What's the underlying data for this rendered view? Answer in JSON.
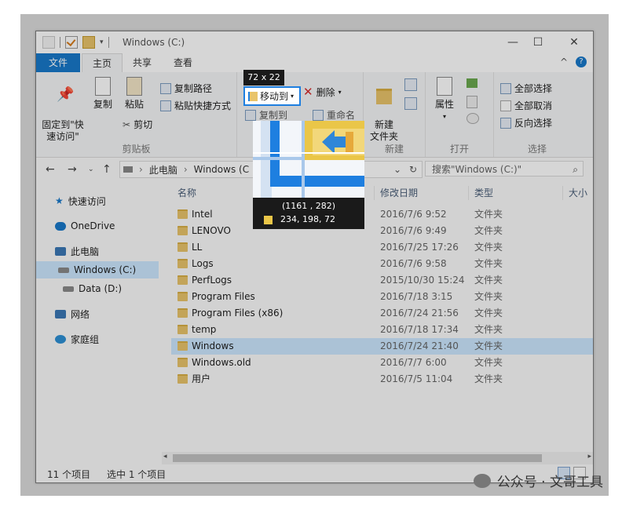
{
  "window": {
    "title": "Windows (C:)",
    "minimize": "—",
    "maximize": "☐",
    "close": "✕"
  },
  "menu": {
    "file": "文件",
    "home": "主页",
    "share": "共享",
    "view": "查看",
    "collapse": "^",
    "help": "?"
  },
  "ribbon": {
    "clipboard": {
      "pin": "固定到\"快\n速访问\"",
      "copy": "复制",
      "paste": "粘贴",
      "copy_path": "复制路径",
      "paste_shortcut": "粘贴快捷方式",
      "cut": "剪切",
      "label": "剪贴板"
    },
    "organize": {
      "move_to": "移动到",
      "copy_to": "复制到",
      "delete": "删除",
      "rename": "重命名"
    },
    "new": {
      "new_folder": "新建\n文件夹",
      "label": "新建"
    },
    "open": {
      "properties": "属性",
      "label": "打开"
    },
    "select": {
      "select_all": "全部选择",
      "select_none": "全部取消",
      "invert": "反向选择",
      "label": "选择"
    }
  },
  "address": {
    "crumb1": "此电脑",
    "crumb2": "Windows (C",
    "search_placeholder": "搜索\"Windows (C:)\""
  },
  "sidebar": {
    "items": [
      {
        "label": "快速访问",
        "icon": "star-icon"
      },
      {
        "label": "OneDrive",
        "icon": "cloud-icon"
      },
      {
        "label": "此电脑",
        "icon": "computer-icon"
      },
      {
        "label": "Windows (C:)",
        "icon": "drive-icon"
      },
      {
        "label": "Data (D:)",
        "icon": "drive-icon"
      },
      {
        "label": "网络",
        "icon": "network-icon"
      },
      {
        "label": "家庭组",
        "icon": "homegroup-icon"
      }
    ]
  },
  "columns": {
    "name": "名称",
    "date": "修改日期",
    "type": "类型",
    "size": "大小"
  },
  "files": [
    {
      "name": "Intel",
      "date": "2016/7/6 9:52",
      "type": "文件夹"
    },
    {
      "name": "LENOVO",
      "date": "2016/7/6 9:49",
      "type": "文件夹"
    },
    {
      "name": "LL",
      "date": "2016/7/25 17:26",
      "type": "文件夹"
    },
    {
      "name": "Logs",
      "date": "2016/7/6 9:58",
      "type": "文件夹"
    },
    {
      "name": "PerfLogs",
      "date": "2015/10/30 15:24",
      "type": "文件夹"
    },
    {
      "name": "Program Files",
      "date": "2016/7/18 3:15",
      "type": "文件夹"
    },
    {
      "name": "Program Files (x86)",
      "date": "2016/7/24 21:56",
      "type": "文件夹"
    },
    {
      "name": "temp",
      "date": "2016/7/18 17:34",
      "type": "文件夹"
    },
    {
      "name": "Windows",
      "date": "2016/7/24 21:40",
      "type": "文件夹"
    },
    {
      "name": "Windows.old",
      "date": "2016/7/7 6:00",
      "type": "文件夹"
    },
    {
      "name": "用户",
      "date": "2016/7/5 11:04",
      "type": "文件夹"
    }
  ],
  "status": {
    "count": "11 个项目",
    "selected": "选中 1 个项目"
  },
  "overlay": {
    "size": "72 x 22",
    "coords": "(1161 , 282)",
    "rgb": "234, 198,  72",
    "swatch_color": "#eac648"
  },
  "watermark": "公众号 · 文哥工具"
}
